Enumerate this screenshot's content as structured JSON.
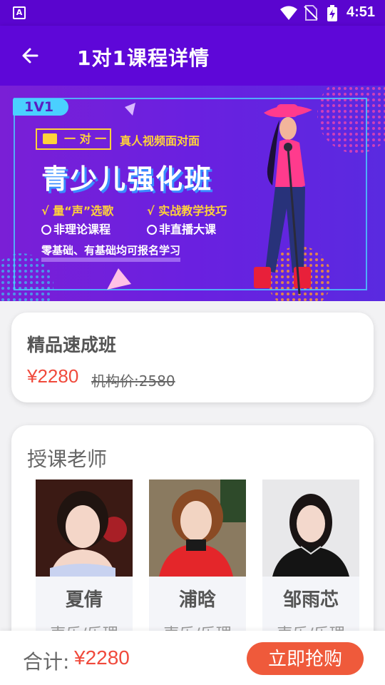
{
  "status_bar": {
    "time": "4:51",
    "app_badge": "A"
  },
  "app_bar": {
    "title": "1对1课程详情"
  },
  "banner": {
    "badge": "1V1",
    "tag_left": "一 对 一",
    "tag_right": "真人视频面对面",
    "headline": "青少儿强化班",
    "features": [
      "√ 量“声”选歌",
      "√ 实战教学技巧",
      "非理论课程",
      "非直播大课"
    ],
    "footer": "零基础、有基础均可报名学习"
  },
  "course": {
    "name": "精品速成班",
    "price": "¥2280",
    "original_price": "机构价:2580"
  },
  "teachers_section": {
    "title": "授课老师",
    "teachers": [
      {
        "name": "夏倩",
        "subject": "声乐/乐理"
      },
      {
        "name": "浦晗",
        "subject": "声乐/乐理"
      },
      {
        "name": "邹雨芯",
        "subject": "声乐/乐理"
      }
    ]
  },
  "bottom_bar": {
    "total_label": "合计:",
    "total_price": "¥2280",
    "buy_label": "立即抢购"
  },
  "colors": {
    "primary": "#5e07d8",
    "accent": "#f04a3c",
    "button": "#ef5a3b"
  }
}
